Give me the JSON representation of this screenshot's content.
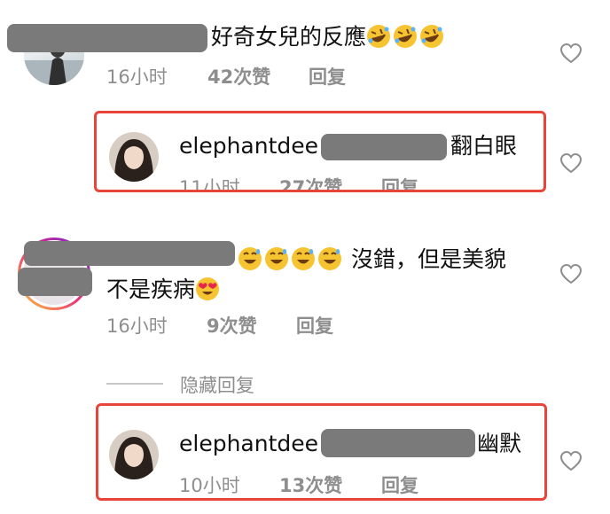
{
  "comments": [
    {
      "text": "好奇女兒的反應",
      "emoji_icons": [
        "rofl-emoji",
        "rofl-emoji",
        "rofl-emoji"
      ],
      "time": "16小时",
      "likes": "42次赞",
      "reply": "回复"
    },
    {
      "username": "elephantdee",
      "text": "翻白眼",
      "time": "11小时",
      "likes": "27次赞",
      "reply": "回复"
    },
    {
      "emoji_icons": [
        "grin-sweat-emoji",
        "grin-sweat-emoji",
        "grin-sweat-emoji",
        "grin-sweat-emoji"
      ],
      "text_line1": "沒錯，但是美貌",
      "text_line2": "不是疾病",
      "emoji_end": "heart-eyes-emoji",
      "time": "16小时",
      "likes": "9次赞",
      "reply": "回复"
    },
    {
      "username": "elephantdee",
      "text": "幽默",
      "time": "10小时",
      "likes": "13次赞",
      "reply": "回复"
    }
  ],
  "hide_replies": "隐藏回复",
  "colors": {
    "highlight": "#e8443a",
    "meta_text": "#8e8e8e",
    "redaction": "#7a7a7a"
  }
}
